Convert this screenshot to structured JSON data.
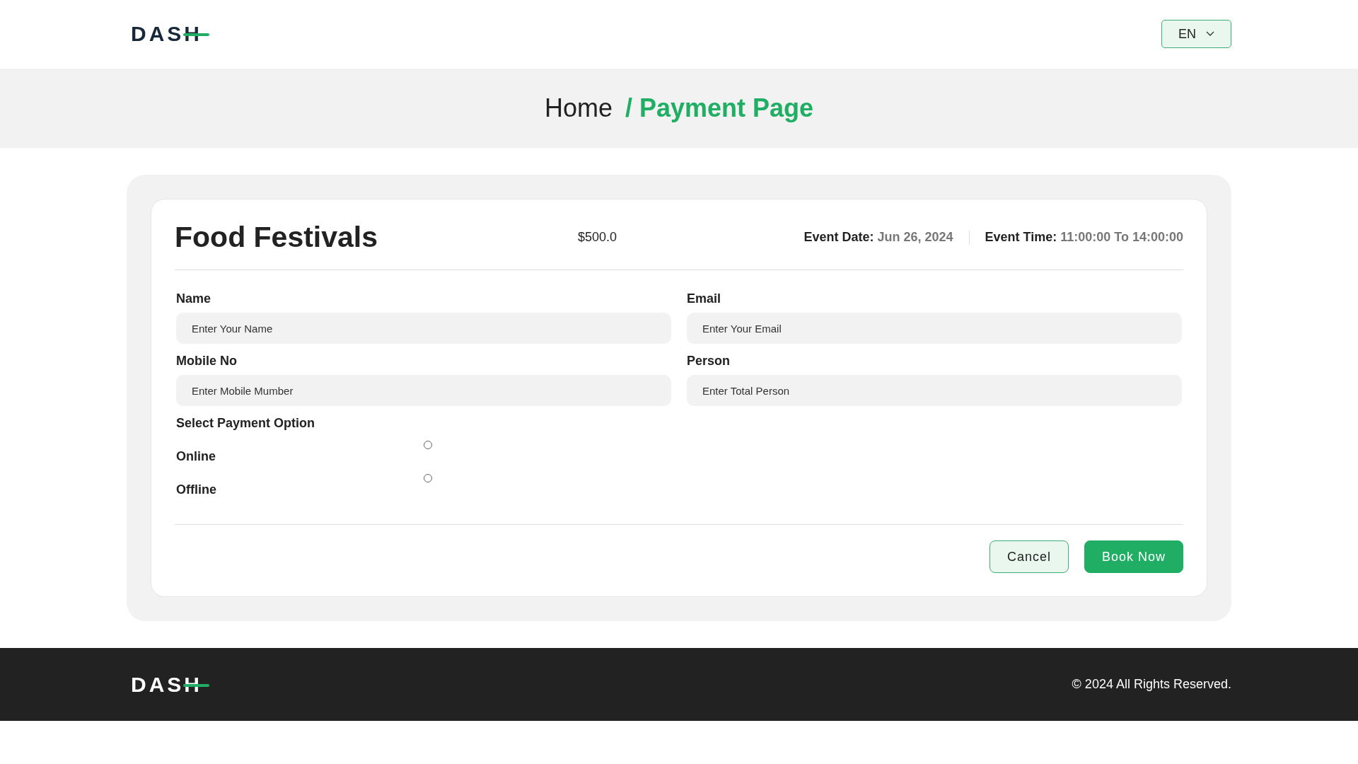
{
  "header": {
    "logo": "DASH",
    "language": "EN"
  },
  "breadcrumb": [
    {
      "label": "Home",
      "selected": false
    },
    {
      "label": "/ Payment Page",
      "selected": true
    }
  ],
  "event": {
    "title": "Food Festivals",
    "price": "$500.0",
    "date_label": "Event Date:",
    "date": "Jun 26, 2024",
    "time_label": "Event Time:",
    "time": "11:00:00 To 14:00:00"
  },
  "fields": [
    {
      "label": "Name",
      "placeholder": "Enter Your Name"
    },
    {
      "label": "Email",
      "placeholder": "Enter Your Email"
    },
    {
      "label": "Mobile No",
      "placeholder": "Enter Mobile Mumber"
    },
    {
      "label": "Person",
      "placeholder": "Enter Total Person"
    }
  ],
  "payment": {
    "title": "Select Payment Option",
    "options": [
      {
        "label": "Online",
        "selected": false
      },
      {
        "label": "Offline",
        "selected": false
      }
    ]
  },
  "buttons": [
    {
      "label": "Cancel",
      "kind": "secondary"
    },
    {
      "label": "Book Now",
      "kind": "primary"
    }
  ],
  "footer": {
    "logo": "DASH",
    "copyright": "© 2024 All Rights Reserved."
  }
}
